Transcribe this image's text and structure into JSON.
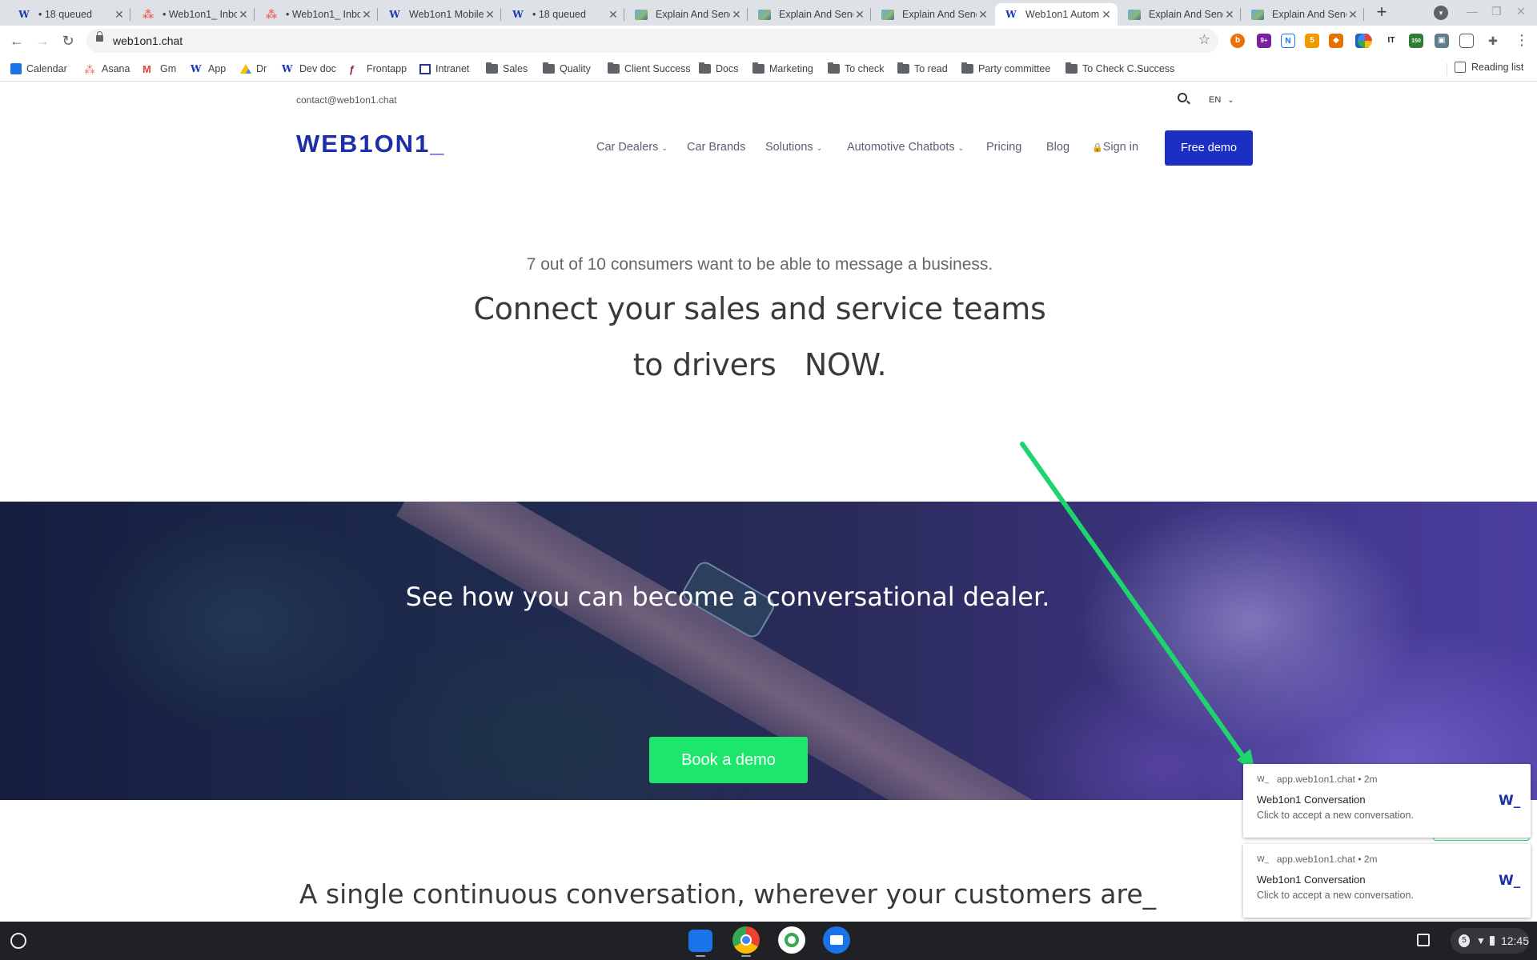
{
  "browser": {
    "tabs": [
      {
        "title": "• 18 queued",
        "favicon": "web1on1-w-icon"
      },
      {
        "title": "• Web1on1_ Inbox",
        "favicon": "asana-icon"
      },
      {
        "title": "• Web1on1_ Inbox",
        "favicon": "asana-icon"
      },
      {
        "title": "Web1on1 Mobile",
        "favicon": "web1on1-w-icon"
      },
      {
        "title": "• 18 queued",
        "favicon": "web1on1-w-icon"
      },
      {
        "title": "Explain And Send",
        "favicon": "image-icon"
      },
      {
        "title": "Explain And Send",
        "favicon": "image-icon"
      },
      {
        "title": "Explain And Send",
        "favicon": "image-icon"
      },
      {
        "title": "Web1on1 Autom",
        "favicon": "web1on1-w-icon",
        "active": true
      },
      {
        "title": "Explain And Send",
        "favicon": "image-icon"
      },
      {
        "title": "Explain And Send",
        "favicon": "image-icon"
      }
    ],
    "url": "web1on1.chat",
    "bookmarks": [
      {
        "label": "Calendar",
        "icon": "calendar-icon"
      },
      {
        "label": "Asana",
        "icon": "asana-icon"
      },
      {
        "label": "Gm",
        "icon": "gmail-icon"
      },
      {
        "label": "App",
        "icon": "web1on1-w-icon"
      },
      {
        "label": "Dr",
        "icon": "drive-icon"
      },
      {
        "label": "Dev doc",
        "icon": "web1on1-w-icon"
      },
      {
        "label": "Frontapp",
        "icon": "frontapp-icon"
      },
      {
        "label": "Intranet",
        "icon": "intranet-icon"
      },
      {
        "label": "Sales",
        "icon": "folder-icon"
      },
      {
        "label": "Quality",
        "icon": "folder-icon"
      },
      {
        "label": "Client Success",
        "icon": "folder-icon"
      },
      {
        "label": "Docs",
        "icon": "folder-icon"
      },
      {
        "label": "Marketing",
        "icon": "folder-icon"
      },
      {
        "label": "To check",
        "icon": "folder-icon"
      },
      {
        "label": "To read",
        "icon": "folder-icon"
      },
      {
        "label": "Party committee",
        "icon": "folder-icon"
      },
      {
        "label": "To Check C.Success",
        "icon": "folder-icon"
      }
    ],
    "reading_list": "Reading list",
    "extension_badges": {
      "ext2": "9+",
      "ext10": "150"
    }
  },
  "site": {
    "contact": "contact@web1on1.chat",
    "lang": "EN",
    "logo": "WEB1ON1_",
    "nav": {
      "car_dealers": "Car Dealers",
      "car_brands": "Car Brands",
      "solutions": "Solutions",
      "automotive_chatbots": "Automotive Chatbots",
      "pricing": "Pricing",
      "blog": "Blog",
      "sign_in": "Sign in"
    },
    "free_demo": "Free demo",
    "hero": {
      "subtitle": "7 out of 10 consumers want to be able to message a business.",
      "line1": "Connect your sales and service teams",
      "line2": "to drivers   NOW."
    },
    "banner": {
      "title": "See how you can become a conversational dealer.",
      "cta": "Book a demo"
    },
    "section_title": "A single continuous conversation, wherever your customers are_"
  },
  "notifications": [
    {
      "origin": "app.web1on1.chat",
      "age": "2m",
      "title": "Web1on1 Conversation",
      "body": "Click to accept a new conversation.",
      "logo": "W_",
      "small_logo": "W_"
    },
    {
      "origin": "app.web1on1.chat",
      "age": "2m",
      "title": "Web1on1 Conversation",
      "body": "Click to accept a new conversation.",
      "logo": "W_",
      "small_logo": "W_"
    }
  ],
  "shelf": {
    "notification_count": "5",
    "time": "12:45",
    "apps": [
      "files-app-icon",
      "chrome-app-icon",
      "ring-app-icon",
      "messages-app-icon"
    ]
  },
  "colors": {
    "brand_blue": "#1b2fa6",
    "cta_blue": "#1b2fc4",
    "cta_green": "#1ce66b",
    "annotation_arrow": "#1ed46e"
  }
}
